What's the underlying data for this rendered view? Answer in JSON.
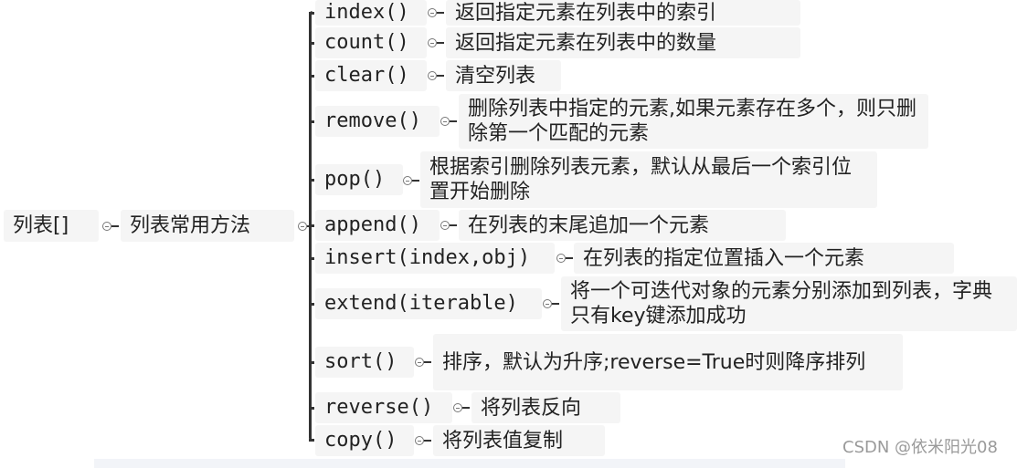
{
  "root": {
    "label": "列表[]"
  },
  "category": {
    "label": "列表常用方法"
  },
  "methods": [
    {
      "name": "index()",
      "desc": "返回指定元素在列表中的索引"
    },
    {
      "name": "count()",
      "desc": "返回指定元素在列表中的数量"
    },
    {
      "name": "clear()",
      "desc": "清空列表"
    },
    {
      "name": "remove()",
      "desc": "删除列表中指定的元素,如果元素存在多个，则只删除第一个匹配的元素"
    },
    {
      "name": "pop()",
      "desc": "根据索引删除列表元素，默认从最后一个索引位置开始删除"
    },
    {
      "name": "append()",
      "desc": "在列表的末尾追加一个元素"
    },
    {
      "name": "insert(index,obj)",
      "desc": "在列表的指定位置插入一个元素"
    },
    {
      "name": "extend(iterable)",
      "desc": "将一个可迭代对象的元素分别添加到列表，字典只有key键添加成功"
    },
    {
      "name": "sort()",
      "desc": "排序，默认为升序;reverse=True时则降序排列"
    },
    {
      "name": "reverse()",
      "desc": "将列表反向"
    },
    {
      "name": "copy()",
      "desc": "将列表值复制"
    }
  ],
  "watermark": "CSDN @依米阳光08",
  "colors": {
    "node_bg": "#f5f5f5",
    "line": "#333333",
    "watermark": "#9a9a9a"
  }
}
